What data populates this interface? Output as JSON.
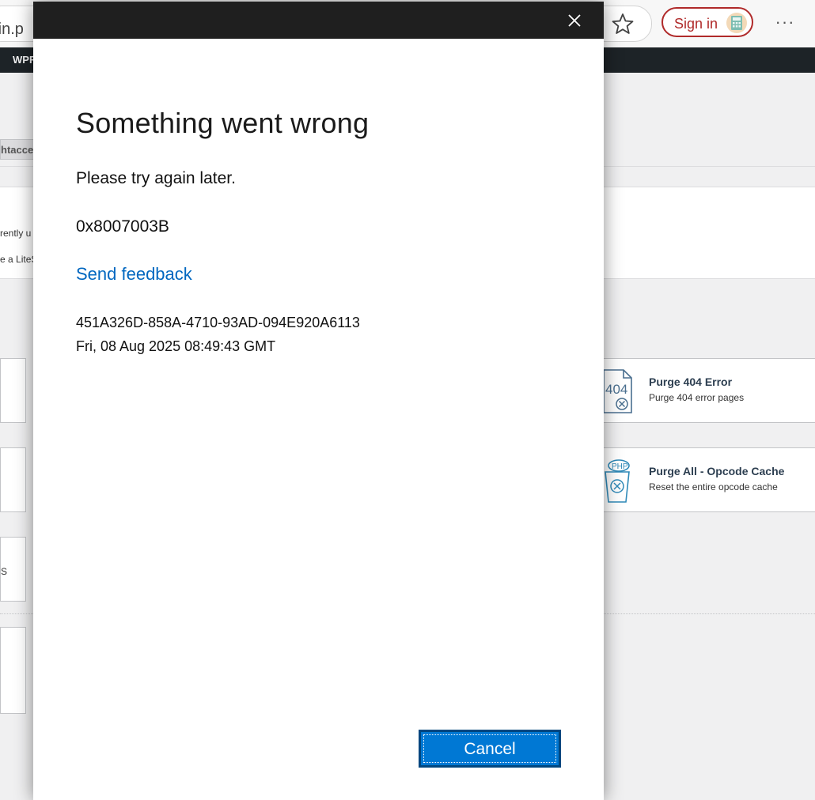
{
  "browser": {
    "address_text": "min.p",
    "signin_label": "Sign in",
    "more_label": "···"
  },
  "admin_bar": {
    "item": "WPF"
  },
  "page": {
    "tab_chip": "htacce",
    "notice_lines": [
      "rently u",
      "e a LiteS"
    ],
    "left_tile_fragment": "S",
    "tiles": [
      {
        "title": "Purge 404 Error",
        "desc": "Purge 404 error pages",
        "icon": "file-404-icon"
      },
      {
        "title": "Purge All - Opcode Cache",
        "desc": "Reset the entire opcode cache",
        "icon": "php-trash-icon"
      }
    ]
  },
  "dialog": {
    "heading": "Something went wrong",
    "message": "Please try again later.",
    "error_code": "0x8007003B",
    "feedback_link": "Send feedback",
    "correlation_id": "451A326D-858A-4710-93AD-094E920A6113",
    "timestamp": "Fri, 08 Aug 2025 08:49:43 GMT",
    "cancel_label": "Cancel"
  },
  "colors": {
    "link": "#0067c0",
    "button_bg": "#0078d4",
    "titlebar": "#1f1f1f",
    "signin": "#b02a2a"
  }
}
